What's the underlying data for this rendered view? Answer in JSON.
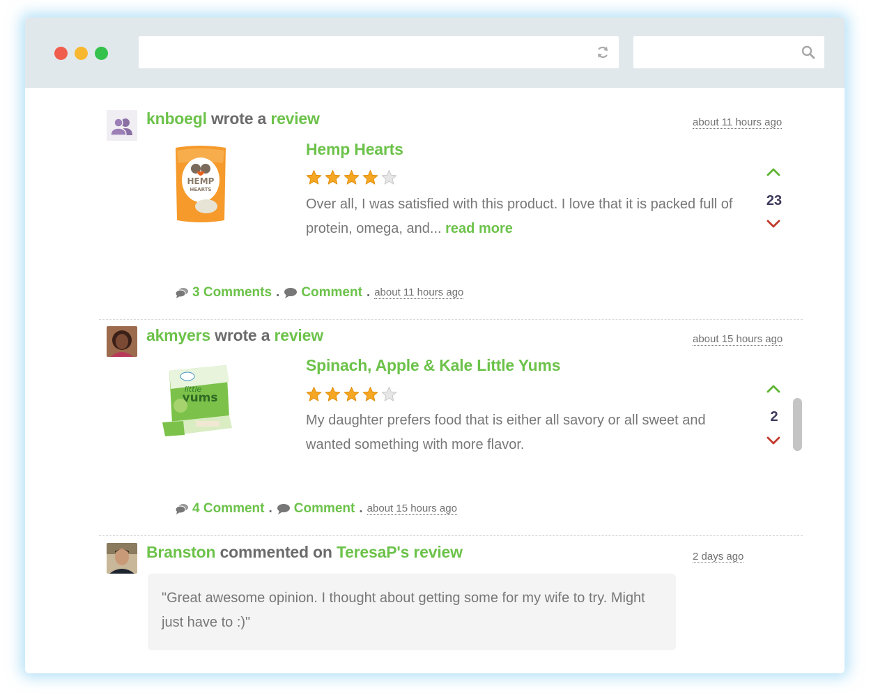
{
  "browser": {
    "url_value": "",
    "search_value": "",
    "icons": {
      "refresh": "refresh-icon",
      "search": "search-icon"
    },
    "dots": [
      "#f05d4d",
      "#f7b830",
      "#34c24c"
    ]
  },
  "colors": {
    "accent": "#6cc24a",
    "vote_up": "#5db531",
    "vote_down": "#c0392b",
    "star": "#f5a623"
  },
  "feed": [
    {
      "user": "knboegl",
      "action": "wrote a",
      "target": "review",
      "time": "about 11 hours ago",
      "product_title": "Hemp Hearts",
      "rating": 4,
      "rating_max": 5,
      "text": "Over all, I was satisfied with this product. I love that it is packed full of protein, omega, and...",
      "read_more": "read more",
      "votes": "23",
      "comments_count_label": "3 Comments",
      "comment_label": "Comment",
      "meta_time": "about 11 hours ago",
      "product_img_text": [
        "HEMP",
        "HEARTS"
      ]
    },
    {
      "user": "akmyers",
      "action": "wrote a",
      "target": "review",
      "time": "about 15 hours ago",
      "product_title": "Spinach, Apple & Kale Little Yums",
      "rating": 4,
      "rating_max": 5,
      "text": "My daughter prefers food that is either all savory or all sweet and wanted something with more flavor.",
      "votes": "2",
      "comments_count_label": "4 Comment",
      "comment_label": "Comment",
      "meta_time": "about 15 hours ago",
      "product_img_text": [
        "little",
        "yums"
      ]
    },
    {
      "user": "Branston",
      "action": "commented on",
      "target": "TeresaP's review",
      "time": "2 days ago",
      "comment": "\"Great awesome opinion. I thought about getting some for my wife to try. Might just have to :)\""
    }
  ],
  "separators": {
    "meta_dot": "."
  }
}
